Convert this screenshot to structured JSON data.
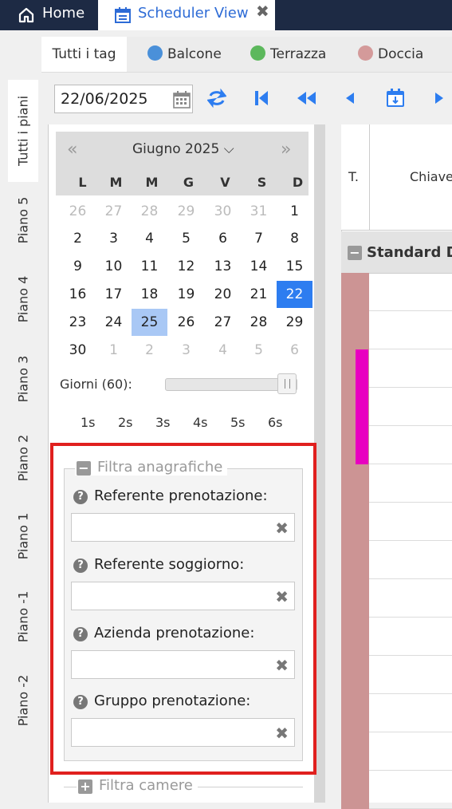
{
  "tabs": {
    "home": "Home",
    "scheduler": "Scheduler View",
    "close_glyph": "✖"
  },
  "tags": [
    {
      "label": "Tutti i tag"
    },
    {
      "label": "Balcone",
      "color": "#4a90d9"
    },
    {
      "label": "Terrazza",
      "color": "#5cb85c"
    },
    {
      "label": "Doccia",
      "color": "#d49a9a"
    }
  ],
  "floors": [
    "Tutti i piani",
    "Piano 5",
    "Piano 4",
    "Piano 3",
    "Piano 2",
    "Piano 1",
    "Piano -1",
    "Piano -2"
  ],
  "toolbar": {
    "date": "22/06/2025",
    "icons": [
      "calendar-icon",
      "refresh-icon",
      "first-icon",
      "rewind-icon",
      "prev-icon",
      "today-icon",
      "next-icon"
    ]
  },
  "calendar": {
    "prev": "«",
    "next": "»",
    "month": "Giugno 2025",
    "chevron": "⌵",
    "dow": [
      "L",
      "M",
      "M",
      "G",
      "V",
      "S",
      "D"
    ],
    "weeks": [
      [
        "26",
        "27",
        "28",
        "29",
        "30",
        "31",
        "1"
      ],
      [
        "2",
        "3",
        "4",
        "5",
        "6",
        "7",
        "8"
      ],
      [
        "9",
        "10",
        "11",
        "12",
        "13",
        "14",
        "15"
      ],
      [
        "16",
        "17",
        "18",
        "19",
        "20",
        "21",
        "22"
      ],
      [
        "23",
        "24",
        "25",
        "26",
        "27",
        "28",
        "29"
      ],
      [
        "30",
        "1",
        "2",
        "3",
        "4",
        "5",
        "6"
      ]
    ],
    "selected_day": "22",
    "highlighted_day": "25"
  },
  "days_label": "Giorni (60):",
  "days_value": 60,
  "spans": [
    "1s",
    "2s",
    "3s",
    "4s",
    "5s",
    "6s"
  ],
  "filter": {
    "legend": "Filtra anagrafiche",
    "collapse_glyph": "−",
    "help_glyph": "?",
    "clear_glyph": "✖",
    "fields": [
      {
        "label": "Referente prenotazione:",
        "value": ""
      },
      {
        "label": "Referente soggiorno:",
        "value": ""
      },
      {
        "label": "Azienda prenotazione:",
        "value": ""
      },
      {
        "label": "Gruppo prenotazione:",
        "value": ""
      }
    ]
  },
  "filter_rooms": {
    "legend": "Filtra camere",
    "expand_glyph": "+"
  },
  "grid": {
    "col_t": "T.",
    "col_key": "Chiave",
    "group": "Standard D",
    "collapse_glyph": "−"
  },
  "colors": {
    "accent": "#2d7df0",
    "nav": "#1d2a44",
    "alert": "#e0201e",
    "room": "#cc9494",
    "booking": "#e800c0"
  }
}
